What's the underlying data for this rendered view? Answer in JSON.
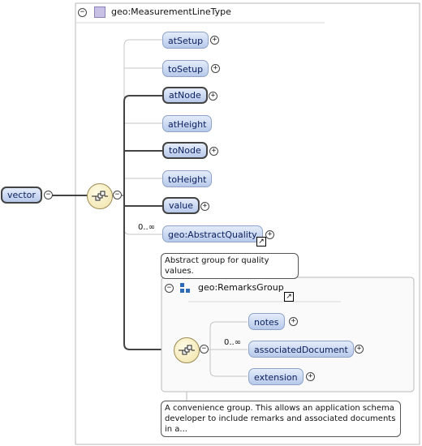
{
  "root": {
    "label": "vector",
    "collapse_glyph": "−"
  },
  "type_box": {
    "title": "geo:MeasurementLineType",
    "collapse_glyph": "−",
    "icon": "complex-type-icon"
  },
  "sequence": {
    "icon": "sequence-compositor-icon",
    "collapse_glyph": "−"
  },
  "elements": [
    {
      "label": "atSetup",
      "required": false,
      "expand": "+"
    },
    {
      "label": "toSetup",
      "required": false,
      "expand": "+"
    },
    {
      "label": "atNode",
      "required": true,
      "expand": "+"
    },
    {
      "label": "atHeight",
      "required": false,
      "expand": ""
    },
    {
      "label": "toNode",
      "required": true,
      "expand": "+"
    },
    {
      "label": "toHeight",
      "required": false,
      "expand": ""
    },
    {
      "label": "value",
      "required": true,
      "expand": "+"
    }
  ],
  "quality": {
    "cardinality": "0..∞",
    "label": "geo:AbstractQuality",
    "expand": "+",
    "note": "Abstract group for quality values."
  },
  "remarks_group": {
    "title": "geo:RemarksGroup",
    "collapse_glyph": "−",
    "icon": "group-icon",
    "sequence_icon": "sequence-compositor-icon",
    "items": [
      {
        "label": "notes",
        "cardinality": "",
        "expand": "+"
      },
      {
        "label": "associatedDocument",
        "cardinality": "0..∞",
        "expand": "+"
      },
      {
        "label": "extension",
        "cardinality": "",
        "expand": "+"
      }
    ],
    "note": "A convenience group. This allows an application schema developer to include remarks and associated documents in a..."
  },
  "colors": {
    "pill_top": "#e4ecfa",
    "pill_bottom": "#b7c9ea",
    "compositor": "#f0e2a6"
  }
}
